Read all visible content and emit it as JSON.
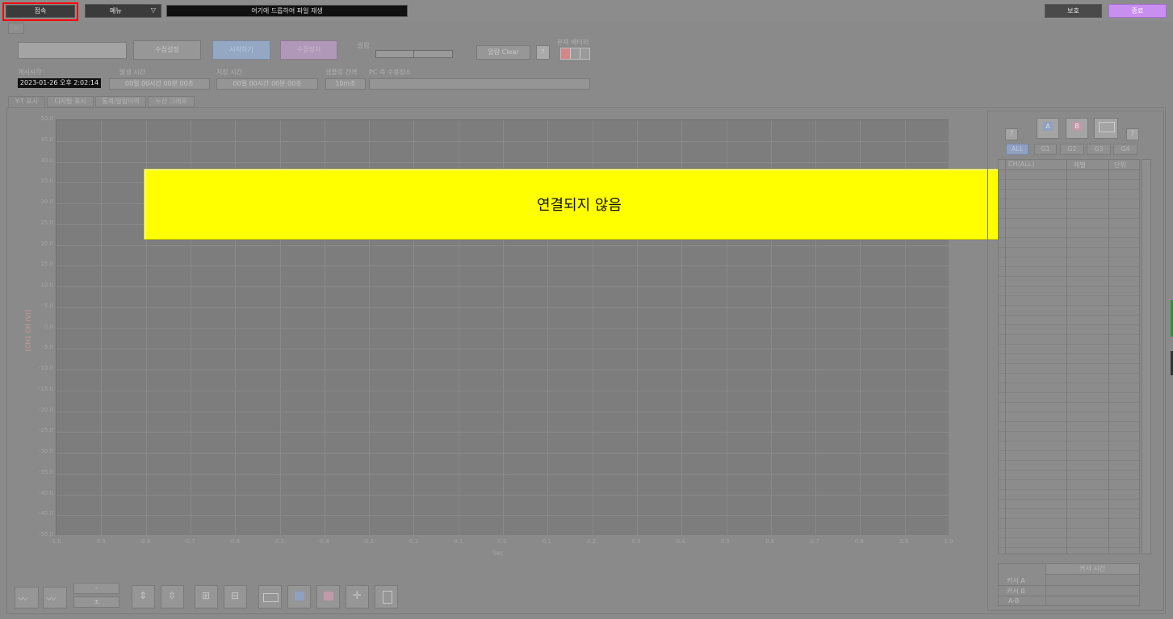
{
  "topbar": {
    "connect_label": "접속",
    "menu_label": "메뉴",
    "file_drop_label": "여기에 드롭하여 파일 재생",
    "protect_label": "보호",
    "exit_label": "종료"
  },
  "small_tab": "-",
  "controls": {
    "collect_settings_label": "수집설정",
    "start_label": "시작하기",
    "stop_label": "수집정지",
    "alarm_label": "알람",
    "alarm_clear_label": "알람 Clear",
    "help_label": "?",
    "battery_label": "본체 배터리"
  },
  "info": {
    "start_time_label": "개시시각",
    "start_time_value": "2023-01-26 오후 2:02:14",
    "elapsed_label": "발생 시간",
    "elapsed_value": "00일 00시간 00분 00초",
    "remaining_label": "저장 시간",
    "remaining_value": "00일 00시간 00분 00초",
    "sampling_label": "샘플링 간격",
    "sampling_value": "10m초",
    "pc_save_label": "PC 측 수용장소"
  },
  "tabs": [
    "Y-T 표시",
    "디지털 표시",
    "통계/알람이력",
    "누산 그래프"
  ],
  "chart": {
    "y_axis_label": "[CH1 CH (V)]",
    "x_axis_label": "Sec",
    "y_ticks": [
      "50.0",
      "45.0",
      "40.0",
      "35.0",
      "30.0",
      "25.0",
      "20.0",
      "15.0",
      "10.0",
      "5.0",
      "0.0",
      "-5.0",
      "-10.0",
      "-15.0",
      "-20.0",
      "-25.0",
      "-30.0",
      "-35.0",
      "-40.0",
      "-45.0",
      "-50.0"
    ],
    "x_ticks": [
      "-1.0",
      "-0.9",
      "-0.8",
      "-0.7",
      "-0.6",
      "-0.5",
      "-0.4",
      "-0.3",
      "-0.2",
      "-0.1",
      "0.0",
      "0.1",
      "0.2",
      "0.3",
      "0.4",
      "0.5",
      "0.6",
      "0.7",
      "0.8",
      "0.9",
      "1.0"
    ]
  },
  "overlay_message": "연결되지 않음",
  "right_panel": {
    "help_left": "?",
    "help_right": "?",
    "cursor_a_icon": "A",
    "cursor_b_icon": "B",
    "group_tabs": [
      "ALL",
      "G1",
      "G2",
      "G3",
      "G4"
    ],
    "table_headers": [
      "CH(ALL)",
      "레벨",
      "단위"
    ],
    "cursor_table": {
      "header": "커서 시간",
      "rows": [
        "커서 A",
        "커서 B",
        "A-B"
      ]
    }
  },
  "bottom_toolbar": {
    "scale_value": "-",
    "scale_unit": "±"
  },
  "colors": {
    "overlay_bg": "#ffff00",
    "exit_button": "#c98ff0",
    "connect_border": "#ff0000",
    "start_button": "#94a8c4",
    "stop_button": "#b098b8",
    "battery_red": "#d08888"
  }
}
